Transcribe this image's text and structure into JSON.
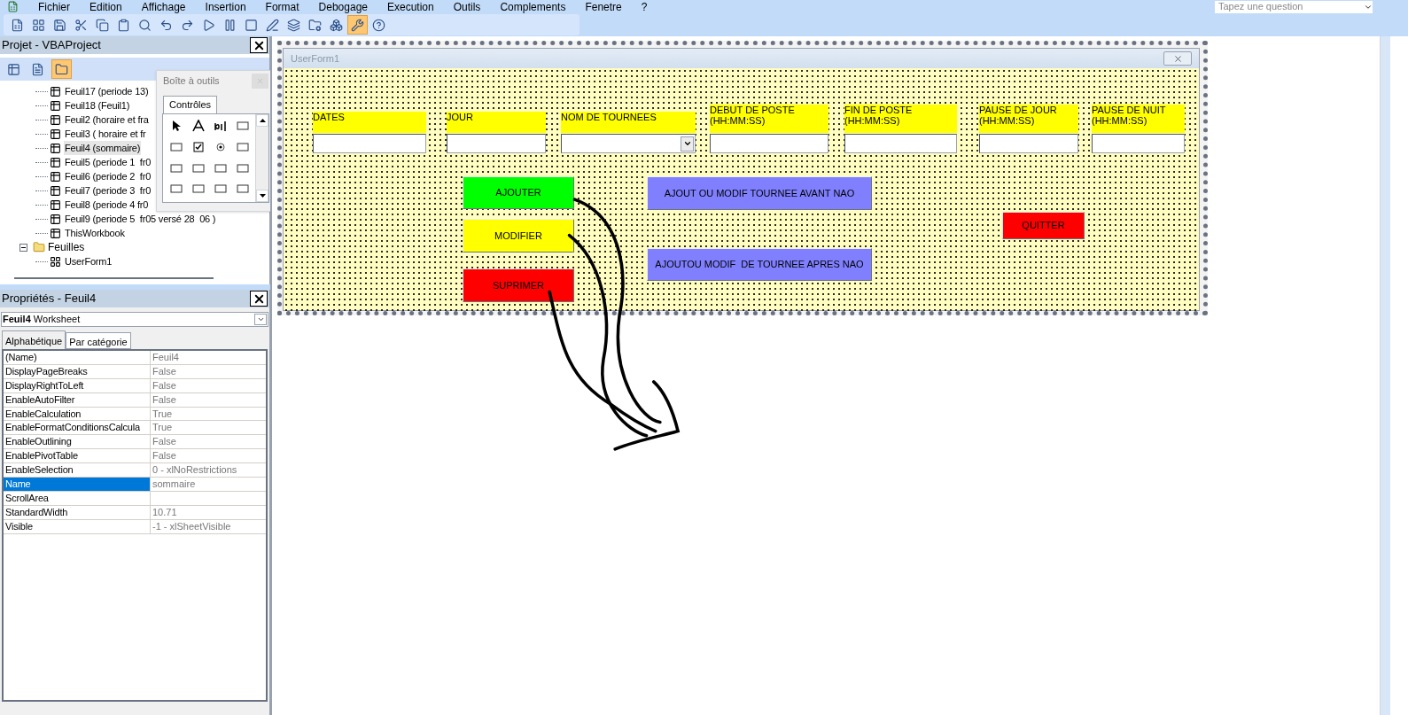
{
  "menu_bar": {
    "items": [
      "Fichier",
      "Edition",
      "Affichage",
      "Insertion",
      "Format",
      "Debogage",
      "Execution",
      "Outils",
      "Complements",
      "Fenetre",
      "?"
    ],
    "help_search": {
      "placeholder": "Tapez une question"
    }
  },
  "project_panel": {
    "title": "Projet - VBAProject",
    "sheet_items": [
      {
        "label": "Feuil17 (periode 13)",
        "selected": false
      },
      {
        "label": "Feuil18 (Feuil1)",
        "selected": false
      },
      {
        "label": "Feuil2 (horaire et fra",
        "selected": false
      },
      {
        "label": "Feuil3 ( horaire et fr",
        "selected": false
      },
      {
        "label": "Feuil4 (sommaire)",
        "selected": true
      },
      {
        "label": "Feuil5 (periode 1  fr0",
        "selected": false
      },
      {
        "label": "Feuil6 (periode 2  fr0",
        "selected": false
      },
      {
        "label": "Feuil7 (periode 3  fr0",
        "selected": false
      },
      {
        "label": "Feuil8 (periode 4 fr0",
        "selected": false
      },
      {
        "label": "Feuil9 (periode 5  fr05 versé 28  06 )",
        "selected": false
      },
      {
        "label": "ThisWorkbook",
        "selected": false
      }
    ],
    "folders": [
      {
        "label": "Feuilles",
        "expanded": true,
        "children": [
          {
            "label": "UserForm1",
            "selected": false
          }
        ]
      }
    ]
  },
  "toolbox": {
    "title": "Boîte à outils",
    "tab": "Contrôles"
  },
  "properties_panel": {
    "title": "Propriétés - Feuil4",
    "object_selector": "**Feuil4** Worksheet",
    "tabs": [
      {
        "label": "Alphabétique",
        "selected": true
      },
      {
        "label": "Par catégorie",
        "selected": false
      }
    ],
    "rows": [
      {
        "name": "(Name)",
        "value": "Feuil4",
        "selected": false
      },
      {
        "name": "DisplayPageBreaks",
        "value": "False",
        "selected": false
      },
      {
        "name": "DisplayRightToLeft",
        "value": "False",
        "selected": false
      },
      {
        "name": "EnableAutoFilter",
        "value": "False",
        "selected": false
      },
      {
        "name": "EnableCalculation",
        "value": "True",
        "selected": false
      },
      {
        "name": "EnableFormatConditionsCalcula",
        "value": "True",
        "selected": false
      },
      {
        "name": "EnableOutlining",
        "value": "False",
        "selected": false
      },
      {
        "name": "EnablePivotTable",
        "value": "False",
        "selected": false
      },
      {
        "name": "EnableSelection",
        "value": "0 - xlNoRestrictions",
        "selected": false
      },
      {
        "name": "Name",
        "value": "sommaire",
        "selected": true
      },
      {
        "name": "ScrollArea",
        "value": "",
        "selected": false
      },
      {
        "name": "StandardWidth",
        "value": "10.71",
        "selected": false
      },
      {
        "name": "Visible",
        "value": "-1 - xlSheetVisible",
        "selected": false
      }
    ]
  },
  "userform": {
    "title": "UserForm1",
    "fields": [
      {
        "label": "DATES",
        "kind": "text"
      },
      {
        "label": "JOUR",
        "kind": "text"
      },
      {
        "label": "NOM DE TOURNEES",
        "kind": "combo"
      },
      {
        "label": "DEBUT DE POSTE\n(HH:MM:SS)",
        "kind": "text"
      },
      {
        "label": "FIN DE POSTE\n(HH:MM:SS)",
        "kind": "text"
      },
      {
        "label": "PAUSE DE JOUR\n(HH:MM:SS)",
        "kind": "text"
      },
      {
        "label": "PAUSE DE NUIT\n(HH:MM:SS)",
        "kind": "text"
      }
    ],
    "buttons": [
      {
        "label": "AJOUTER",
        "color": "#00ff00"
      },
      {
        "label": "MODIFIER",
        "color": "#ffff00"
      },
      {
        "label": "SUPRIMER",
        "color": "#ff0000"
      },
      {
        "label": "AJOUT OU MODIF TOURNEE AVANT NAO",
        "color": "#8080ff"
      },
      {
        "label": "AJOUTOU MODIF  DE TOURNEE APRES NAO",
        "color": "#8080ff"
      },
      {
        "label": "QUITTER",
        "color": "#ff0000"
      }
    ]
  }
}
